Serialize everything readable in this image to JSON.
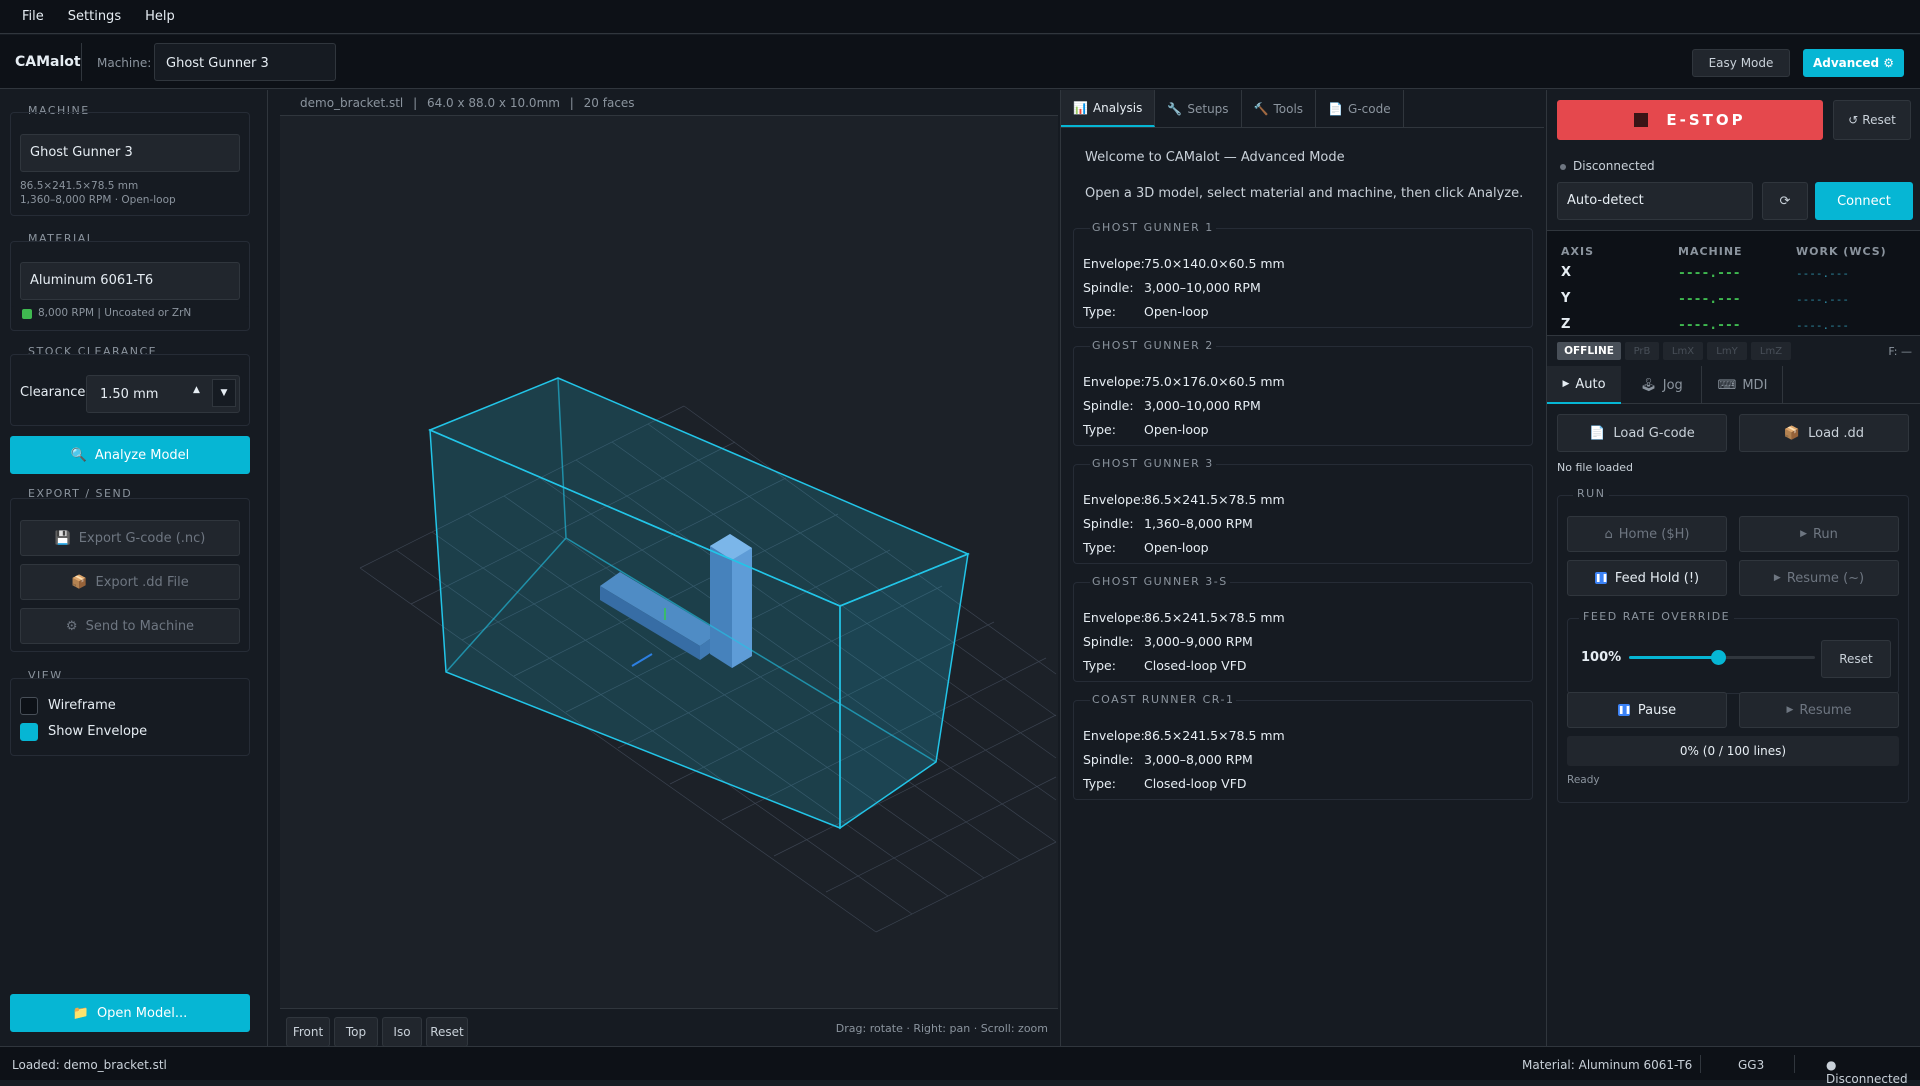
{
  "menu": {
    "file": "File",
    "settings": "Settings",
    "help": "Help"
  },
  "header": {
    "brand": "CAMalot",
    "machine_label": "Machine:",
    "machine_value": "Ghost Gunner 3",
    "easy_mode": "Easy Mode",
    "advanced": "Advanced ⚙"
  },
  "sidebar": {
    "machine_title": "MACHINE",
    "machine_value": "Ghost Gunner 3",
    "machine_dims": "86.5×241.5×78.5 mm",
    "machine_info": "1,360–8,000 RPM · Open-loop",
    "material_title": "MATERIAL",
    "material_value": "Aluminum 6061-T6",
    "material_info": "8,000 RPM  |  Uncoated or ZrN",
    "stock_title": "STOCK CLEARANCE",
    "clearance_label": "Clearance:",
    "clearance_value": "1.50 mm",
    "analyze": "Analyze Model",
    "export_title": "EXPORT / SEND",
    "export_gcode": "Export G-code (.nc)",
    "export_dd": "Export .dd File",
    "send": "Send to Machine",
    "view_title": "VIEW",
    "wireframe": "Wireframe",
    "show_envelope": "Show Envelope",
    "open_model": "Open Model..."
  },
  "viewport": {
    "file": "demo_bracket.stl",
    "dims": "64.0 x 88.0 x 10.0mm",
    "faces": "20 faces",
    "btn_front": "Front",
    "btn_top": "Top",
    "btn_iso": "Iso",
    "btn_reset": "Reset",
    "hint": "Drag: rotate · Right: pan · Scroll: zoom"
  },
  "analysis": {
    "tabs": [
      "Analysis",
      "Setups",
      "Tools",
      "G-code"
    ],
    "welcome": "Welcome to CAMalot — Advanced Mode",
    "instructions": "Open a 3D model, select material and machine, then click Analyze.",
    "labels": {
      "envelope": "Envelope:",
      "spindle": "Spindle:",
      "type": "Type:"
    },
    "machines": [
      {
        "name": "GHOST GUNNER 1",
        "envelope": "75.0×140.0×60.5 mm",
        "spindle": "3,000–10,000 RPM",
        "type": "Open-loop"
      },
      {
        "name": "GHOST GUNNER 2",
        "envelope": "75.0×176.0×60.5 mm",
        "spindle": "3,000–10,000 RPM",
        "type": "Open-loop"
      },
      {
        "name": "GHOST GUNNER 3",
        "envelope": "86.5×241.5×78.5 mm",
        "spindle": "1,360–8,000 RPM",
        "type": "Open-loop"
      },
      {
        "name": "GHOST GUNNER 3-S",
        "envelope": "86.5×241.5×78.5 mm",
        "spindle": "3,000–9,000 RPM",
        "type": "Closed-loop VFD"
      },
      {
        "name": "COAST RUNNER CR-1",
        "envelope": "86.5×241.5×78.5 mm",
        "spindle": "3,000–8,000 RPM",
        "type": "Closed-loop VFD"
      }
    ]
  },
  "control": {
    "estop": "E-STOP",
    "reset": "Reset",
    "conn_status": "Disconnected",
    "port": "Auto-detect",
    "refresh": "⟳",
    "connect": "Connect",
    "dro_headers": {
      "axis": "AXIS",
      "machine": "MACHINE",
      "work": "WORK (WCS)"
    },
    "dro": [
      {
        "axis": "X",
        "machine": "----.---",
        "work": "----.---"
      },
      {
        "axis": "Y",
        "machine": "----.---",
        "work": "----.---"
      },
      {
        "axis": "Z",
        "machine": "----.---",
        "work": "----.---"
      }
    ],
    "state": "OFFLINE",
    "pins": [
      "PrB",
      "LmX",
      "LmY",
      "LmZ"
    ],
    "feed": "F: —",
    "tabs": [
      "Auto",
      "Jog",
      "MDI"
    ],
    "load_gcode": "Load G-code",
    "load_dd": "Load .dd",
    "file_status": "No file loaded",
    "run_title": "RUN",
    "home": "Home ($H)",
    "run": "Run",
    "feed_hold": "Feed Hold (!)",
    "resume_tilde": "Resume (~)",
    "feed_title": "FEED RATE OVERRIDE",
    "feed_pct": "100%",
    "feed_fraction": 0.48,
    "feed_reset": "Reset",
    "pause": "Pause",
    "resume": "Resume",
    "progress": "0%  (0 / 100 lines)",
    "progress_value": 0,
    "ready": "Ready"
  },
  "statusbar": {
    "loaded": "Loaded: demo_bracket.stl",
    "material": "Material: Aluminum 6061-T6",
    "machine": "GG3",
    "connection": "● Disconnected"
  },
  "colors": {
    "accent": "#06b6d4",
    "estop": "#e5484d",
    "dro_machine": "#3fb950",
    "dro_work": "#2f8fa8"
  }
}
